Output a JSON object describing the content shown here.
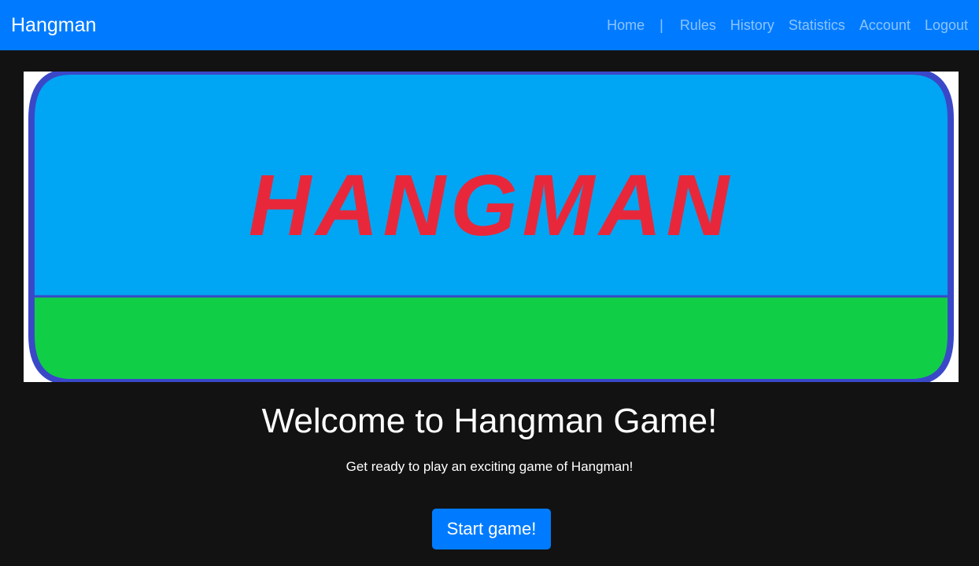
{
  "navbar": {
    "brand": "Hangman",
    "separator": "|",
    "links": {
      "home": "Home",
      "rules": "Rules",
      "history": "History",
      "statistics": "Statistics",
      "account": "Account",
      "logout": "Logout"
    },
    "colors": {
      "background": "#007bff",
      "link": "rgba(255,255,255,0.55)"
    }
  },
  "banner": {
    "title_text": "HANGMAN",
    "colors": {
      "sky": "#00a5f3",
      "grass": "#10cf47",
      "border": "#3a48c8",
      "text": "#e8283a"
    }
  },
  "main": {
    "heading": "Welcome to Hangman Game!",
    "subtitle": "Get ready to play an exciting game of Hangman!",
    "start_button": "Start game!"
  }
}
